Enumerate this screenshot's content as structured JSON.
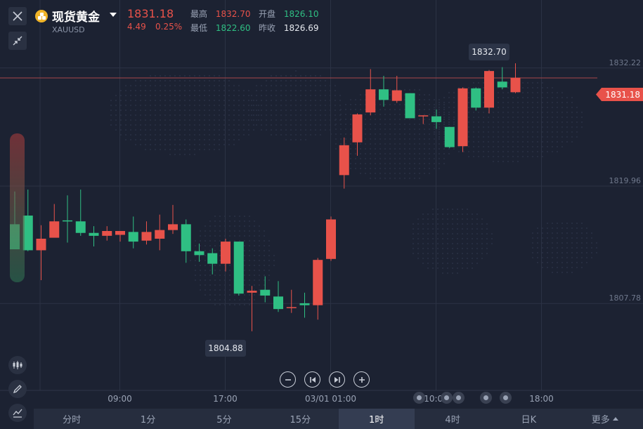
{
  "header": {
    "title": "现货黄金",
    "symbol": "XAUUSD",
    "last_price": "1831.18",
    "change": "4.49",
    "change_pct": "0.25%",
    "high_label": "最高",
    "high_value": "1832.70",
    "low_label": "最低",
    "low_value": "1822.60",
    "open_label": "开盘",
    "open_value": "1826.10",
    "prev_close_label": "昨收",
    "prev_close_value": "1826.69"
  },
  "colors": {
    "up": "#e8524a",
    "down": "#2fbf83",
    "background": "#1c2232",
    "grid": "#2b3244"
  },
  "icons": {
    "close": "close-icon",
    "collapse": "collapse-arrows-icon",
    "candles": "candlestick-icon",
    "draw": "pencil-icon",
    "indicator": "indicator-chart-icon",
    "zoom_out": "minus-icon",
    "prev": "skip-back-icon",
    "next": "skip-forward-icon",
    "zoom_in": "plus-icon"
  },
  "timeframes": {
    "items": [
      "分时",
      "1分",
      "5分",
      "15分",
      "1时",
      "4时",
      "日K",
      "更多"
    ],
    "active": "1时"
  },
  "chart_data": {
    "type": "candlestick",
    "y_ticks": [
      1832.22,
      1819.96,
      1807.78
    ],
    "y_tick_labels": [
      "1832.22",
      "1819.96",
      "1807.78"
    ],
    "ylim": [
      1798.76,
      1839.27
    ],
    "x_tick_labels": [
      "09:00",
      "17:00",
      "03/01 01:00",
      "10:00",
      "18:00"
    ],
    "x_tick_index": [
      8,
      16,
      24,
      32,
      40
    ],
    "current_price": 1831.18,
    "current_price_label": "1831.18",
    "high_marker": {
      "index": 36,
      "value": 1832.7,
      "label": "1832.70"
    },
    "low_marker": {
      "index": 16,
      "value": 1804.88,
      "label": "1804.88"
    },
    "grid": true,
    "candles": [
      {
        "o": 1816.0,
        "h": 1819.4,
        "l": 1813.5,
        "c": 1813.4
      },
      {
        "o": 1816.9,
        "h": 1819.6,
        "l": 1813.2,
        "c": 1813.3
      },
      {
        "o": 1813.3,
        "h": 1815.9,
        "l": 1810.2,
        "c": 1814.5
      },
      {
        "o": 1814.6,
        "h": 1818.1,
        "l": 1815.6,
        "c": 1816.3
      },
      {
        "o": 1816.4,
        "h": 1819.0,
        "l": 1814.1,
        "c": 1816.3
      },
      {
        "o": 1816.3,
        "h": 1819.6,
        "l": 1814.8,
        "c": 1815.1
      },
      {
        "o": 1815.1,
        "h": 1815.8,
        "l": 1813.7,
        "c": 1814.8
      },
      {
        "o": 1814.8,
        "h": 1815.8,
        "l": 1814.3,
        "c": 1815.3
      },
      {
        "o": 1814.9,
        "h": 1815.3,
        "l": 1814.2,
        "c": 1815.3
      },
      {
        "o": 1815.2,
        "h": 1816.8,
        "l": 1813.5,
        "c": 1814.2
      },
      {
        "o": 1814.3,
        "h": 1816.3,
        "l": 1813.9,
        "c": 1815.2
      },
      {
        "o": 1814.5,
        "h": 1817.0,
        "l": 1813.3,
        "c": 1815.4
      },
      {
        "o": 1815.4,
        "h": 1818.0,
        "l": 1815.0,
        "c": 1816.0
      },
      {
        "o": 1816.0,
        "h": 1816.5,
        "l": 1812.0,
        "c": 1813.2
      },
      {
        "o": 1813.2,
        "h": 1814.0,
        "l": 1812.1,
        "c": 1812.8
      },
      {
        "o": 1813.0,
        "h": 1813.5,
        "l": 1810.8,
        "c": 1811.9
      },
      {
        "o": 1811.9,
        "h": 1814.5,
        "l": 1811.1,
        "c": 1814.2
      },
      {
        "o": 1814.2,
        "h": 1814.2,
        "l": 1808.6,
        "c": 1808.8
      },
      {
        "o": 1808.9,
        "h": 1809.6,
        "l": 1804.9,
        "c": 1809.1
      },
      {
        "o": 1809.2,
        "h": 1810.6,
        "l": 1807.9,
        "c": 1808.6
      },
      {
        "o": 1808.5,
        "h": 1810.1,
        "l": 1806.9,
        "c": 1807.2
      },
      {
        "o": 1807.4,
        "h": 1809.2,
        "l": 1806.8,
        "c": 1807.4
      },
      {
        "o": 1807.8,
        "h": 1808.9,
        "l": 1806.3,
        "c": 1807.6
      },
      {
        "o": 1807.6,
        "h": 1812.5,
        "l": 1806.1,
        "c": 1812.3
      },
      {
        "o": 1812.4,
        "h": 1816.8,
        "l": 1812.2,
        "c": 1816.5
      },
      {
        "o": 1821.1,
        "h": 1825.0,
        "l": 1819.7,
        "c": 1824.2
      },
      {
        "o": 1824.5,
        "h": 1827.5,
        "l": 1823.1,
        "c": 1827.4
      },
      {
        "o": 1827.6,
        "h": 1832.1,
        "l": 1827.3,
        "c": 1830.0
      },
      {
        "o": 1830.0,
        "h": 1831.4,
        "l": 1828.2,
        "c": 1828.9
      },
      {
        "o": 1828.8,
        "h": 1831.4,
        "l": 1828.6,
        "c": 1829.9
      },
      {
        "o": 1829.6,
        "h": 1829.6,
        "l": 1827.3,
        "c": 1827.0
      },
      {
        "o": 1827.3,
        "h": 1827.3,
        "l": 1826.4,
        "c": 1827.3
      },
      {
        "o": 1827.2,
        "h": 1827.9,
        "l": 1825.9,
        "c": 1826.6
      },
      {
        "o": 1826.1,
        "h": 1826.1,
        "l": 1823.9,
        "c": 1824.0
      },
      {
        "o": 1824.1,
        "h": 1830.2,
        "l": 1823.5,
        "c": 1830.1
      },
      {
        "o": 1830.1,
        "h": 1830.2,
        "l": 1827.8,
        "c": 1828.1
      },
      {
        "o": 1828.1,
        "h": 1832.0,
        "l": 1827.5,
        "c": 1831.9
      },
      {
        "o": 1830.8,
        "h": 1832.3,
        "l": 1830.0,
        "c": 1830.2
      },
      {
        "o": 1829.7,
        "h": 1832.7,
        "l": 1829.6,
        "c": 1831.2
      }
    ]
  }
}
